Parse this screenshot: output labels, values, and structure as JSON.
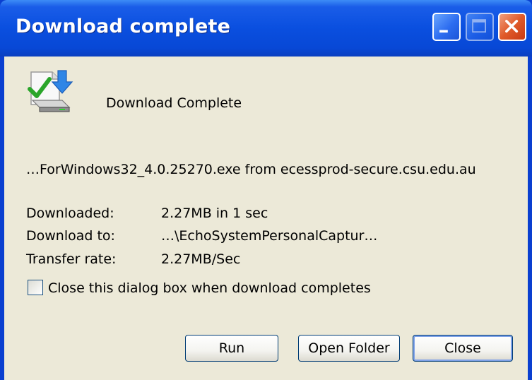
{
  "window": {
    "title": "Download complete"
  },
  "heading": "Download Complete",
  "file_line": "…ForWindows32_4.0.25270.exe from ecessprod-secure.csu.edu.au",
  "details": [
    {
      "label": "Downloaded:",
      "value": "2.27MB in 1 sec"
    },
    {
      "label": "Download to:",
      "value": "…\\EchoSystemPersonalCaptur…"
    },
    {
      "label": "Transfer rate:",
      "value": "2.27MB/Sec"
    }
  ],
  "checkbox": {
    "label": "Close this dialog box when download completes",
    "checked": false
  },
  "buttons": {
    "run": "Run",
    "open_folder": "Open Folder",
    "close": "Close"
  },
  "icons": {
    "main": "download-complete-icon",
    "minimize": "minimize-icon",
    "maximize": "maximize-icon",
    "close": "close-icon"
  },
  "colors": {
    "titlebar": "#0a4fdf",
    "client_bg": "#ece9d8",
    "close_button": "#e05a2a"
  }
}
